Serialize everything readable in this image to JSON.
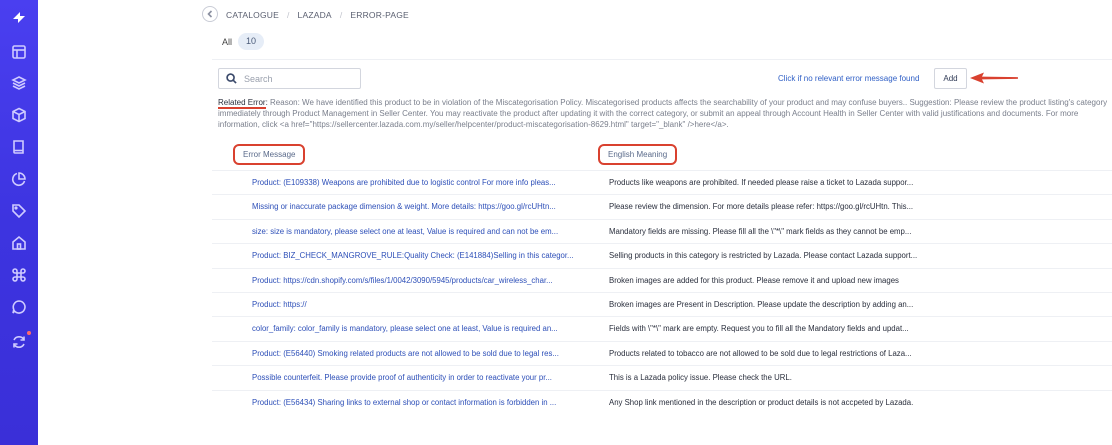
{
  "sidebar": {
    "items": [
      {
        "icon": "logo-icon"
      },
      {
        "icon": "layout-icon"
      },
      {
        "icon": "layers-icon"
      },
      {
        "icon": "box-icon"
      },
      {
        "icon": "book-icon"
      },
      {
        "icon": "pie-chart-icon"
      },
      {
        "icon": "tag-icon"
      },
      {
        "icon": "home-icon"
      },
      {
        "icon": "command-icon"
      },
      {
        "icon": "chat-icon"
      },
      {
        "icon": "sync-icon"
      }
    ]
  },
  "breadcrumb": [
    "CATALOGUE",
    "LAZADA",
    "ERROR-PAGE"
  ],
  "filter": {
    "label": "All",
    "count": "10"
  },
  "search": {
    "placeholder": "Search"
  },
  "hint": "Click if no relevant error message found",
  "add_label": "Add",
  "related": {
    "label": "Related Error:",
    "text": " Reason: We have identified this product to be in violation of the Miscategorisation Policy. Miscategorised products affects the searchability of your product and may confuse buyers.. Suggestion: Please review the product listing's category immediately through Product Management in Seller Center. You may reactivate the product after updating it with the correct category, or submit an appeal through Account Health in Seller Center with valid justifications and documents. For more information, click <a href=\"https://sellercenter.lazada.com.my/seller/helpcenter/product-miscategorisation-8629.html\" target=\"_blank\" />here</a>."
  },
  "columns": {
    "error": "Error Message",
    "english": "English Meaning"
  },
  "rows": [
    {
      "error": "Product: (E109338) Weapons are prohibited due to logistic control For more info pleas...",
      "meaning": "Products like weapons are prohibited. If needed please raise a ticket to Lazada suppor..."
    },
    {
      "error": "Missing or inaccurate package dimension & weight. More details: https://goo.gl/rcUHtn...",
      "meaning": "Please review the dimension. For more details please refer: https://goo.gl/rcUHtn. This..."
    },
    {
      "error": "size: size is mandatory, please select one at least, Value is required and can not be em...",
      "meaning": "Mandatory fields are missing. Please fill all the \\\"*\\\" mark fields as they cannot be emp..."
    },
    {
      "error": "Product: BIZ_CHECK_MANGROVE_RULE:Quality Check: (E141884)Selling in this categor...",
      "meaning": "Selling products in this category is restricted by Lazada. Please contact Lazada support..."
    },
    {
      "error": "Product: https://cdn.shopify.com/s/files/1/0042/3090/5945/products/car_wireless_char...",
      "meaning": "Broken images are added for this product. Please remove it and upload new images"
    },
    {
      "error": "Product: https://",
      "meaning": "Broken images are Present in Description. Please update the description by adding an..."
    },
    {
      "error": "color_family: color_family is mandatory, please select one at least, Value is required an...",
      "meaning": "Fields with \\\"*\\\" mark are empty. Request you to fill all the Mandatory fields and updat..."
    },
    {
      "error": "Product: (E56440) Smoking related products are not allowed to be sold due to legal res...",
      "meaning": "Products related to tobacco are not allowed to be sold due to legal restrictions of Laza..."
    },
    {
      "error": "Possible counterfeit. Please provide proof of authenticity in order to reactivate your pr...",
      "meaning": "This is a Lazada policy issue. Please check the URL."
    },
    {
      "error": "Product: (E56434) Sharing links to external shop or contact information is forbidden in ...",
      "meaning": "Any Shop link mentioned in the description or product details is not accpeted by Lazada."
    }
  ],
  "colors": {
    "sidebar": "#3d34e0",
    "link": "#2d4fb8",
    "annotation": "#d9412f"
  }
}
